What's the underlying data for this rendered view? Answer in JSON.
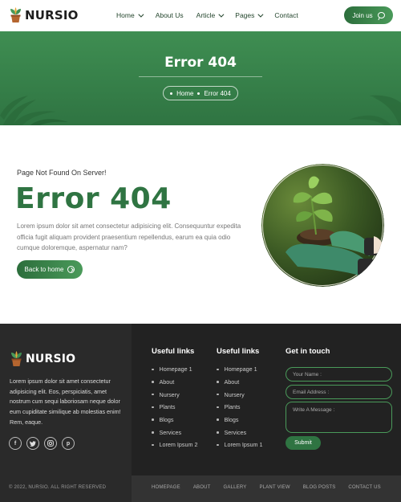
{
  "brand": {
    "name": "NURSIO"
  },
  "nav": {
    "items": [
      {
        "label": "Home",
        "dropdown": true
      },
      {
        "label": "About Us",
        "dropdown": false
      },
      {
        "label": "Article",
        "dropdown": true
      },
      {
        "label": "Pages",
        "dropdown": true
      },
      {
        "label": "Contact",
        "dropdown": false
      }
    ],
    "join_label": "Join us"
  },
  "hero": {
    "title": "Error 404",
    "breadcrumb": {
      "home": "Home",
      "current": "Error 404"
    }
  },
  "main": {
    "subheading": "Page Not Found On Server!",
    "title": "Error 404",
    "body": "Lorem ipsum dolor sit amet consectetur adipisicing elit. Consequuntur expedita officia fugit aliquam provident praesentium repellendus, earum ea quia odio cumque doloremque, aspernatur nam?",
    "back_label": "Back to home"
  },
  "footer": {
    "about": "Lorem ipsum dolor sit amet consectetur adipisicing elit. Eos, perspiciatis, amet nostrum cum sequi laboriosam neque dolor eum cupiditate similique ab molestias enim! Rem, eaque.",
    "socials": [
      "facebook-icon",
      "twitter-icon",
      "instagram-icon",
      "pinterest-icon"
    ],
    "useful_links_1": {
      "title": "Useful links",
      "items": [
        "Homepage 1",
        "About",
        "Nursery",
        "Plants",
        "Blogs",
        "Services",
        "Lorem Ipsum 2"
      ]
    },
    "useful_links_2": {
      "title": "Useful links",
      "items": [
        "Homepage 1",
        "About",
        "Nursery",
        "Plants",
        "Blogs",
        "Services",
        "Lorem Ipsum 1"
      ]
    },
    "contact": {
      "title": "Get in touch",
      "name_placeholder": "Your Name :",
      "email_placeholder": "Email Address :",
      "message_placeholder": "Write A Message :",
      "submit_label": "Submit"
    },
    "copyright": "© 2022, NURSIO. ALL RIGHT RESERVED",
    "bottom_links": [
      "HOMEPAGE",
      "ABOUT",
      "GALLERY",
      "PLANT VIEW",
      "BLOG POSTS",
      "CONTACT US"
    ]
  },
  "colors": {
    "accent": "#2f7442",
    "footer_bg": "#222222"
  }
}
